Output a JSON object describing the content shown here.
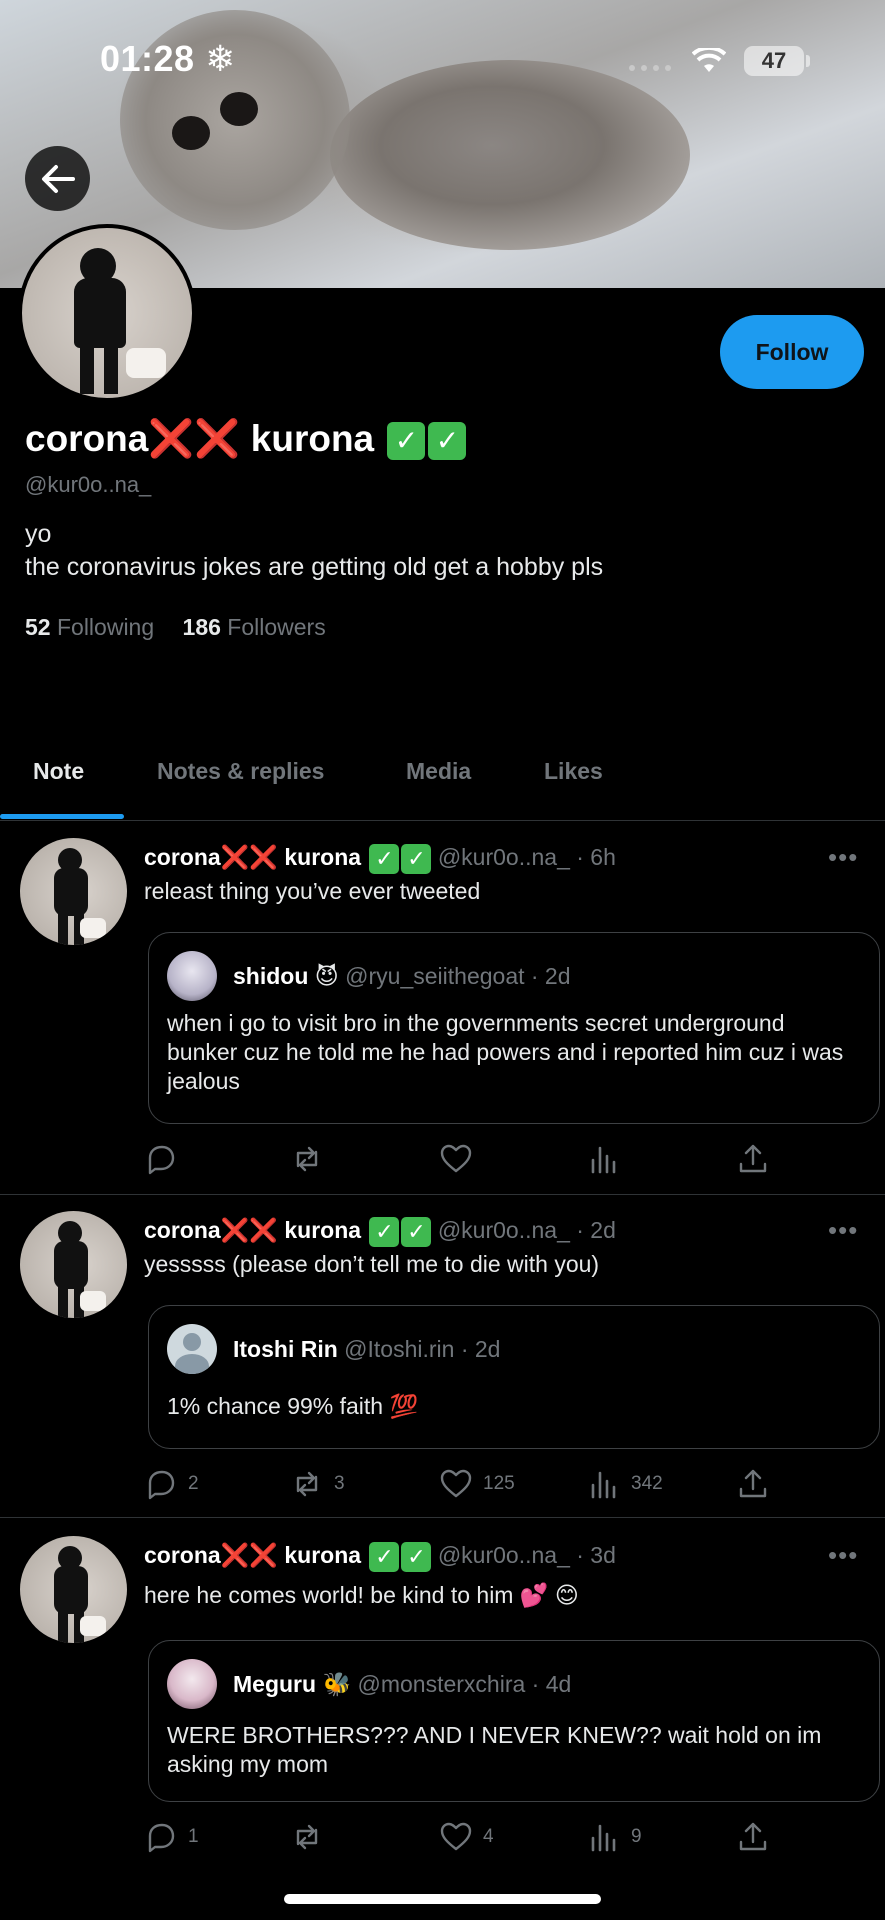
{
  "status_bar": {
    "time": "01:28",
    "time_extra": "❄",
    "battery": "47"
  },
  "profile": {
    "name_part1": "corona",
    "name_x": "❌❌",
    "name_part2": "kurona",
    "name_check": "✓",
    "handle": "@kur0o..na_",
    "bio_line1": "yo",
    "bio_line2": "the coronavirus jokes are getting old get a hobby pls",
    "following_count": "52",
    "following_label": "Following",
    "followers_count": "186",
    "followers_label": "Followers",
    "follow_button": "Follow"
  },
  "tabs": [
    {
      "label": "Note"
    },
    {
      "label": "Notes & replies"
    },
    {
      "label": "Media"
    },
    {
      "label": "Likes"
    }
  ],
  "posts": [
    {
      "author": "corona",
      "author_x": "❌❌",
      "author2": "kurona",
      "check": "✓",
      "meta": "@kur0o..na_ · 6h",
      "text": "releast thing you’ve ever tweeted",
      "quote": {
        "name": "shidou",
        "emoji": "😈",
        "meta": "@ryu_seiithegoat · 2d",
        "text": "when i go to visit bro in the governments secret underground bunker cuz he told me he had powers and i reported him cuz i was jealous"
      },
      "replies": "",
      "reposts": "",
      "likes": "",
      "views": ""
    },
    {
      "author": "corona",
      "author_x": "❌❌",
      "author2": "kurona",
      "check": "✓",
      "meta": "@kur0o..na_ · 2d",
      "text": "yesssss (please don’t tell me to die with you)",
      "quote": {
        "name": "Itoshi Rin",
        "emoji": "",
        "meta": "@Itoshi.rin · 2d",
        "text": "1% chance 99% faith 💯"
      },
      "replies": "2",
      "reposts": "3",
      "likes": "125",
      "views": "342"
    },
    {
      "author": "corona",
      "author_x": "❌❌",
      "author2": "kurona",
      "check": "✓",
      "meta": "@kur0o..na_ · 3d",
      "text": "here he comes world! be kind to him 💕 😊",
      "quote": {
        "name": "Meguru",
        "emoji": "🐝",
        "meta": "@monsterxchira · 4d",
        "text": "WERE BROTHERS??? AND I NEVER KNEW?? wait hold on im asking my mom"
      },
      "replies": "1",
      "reposts": "",
      "likes": "4",
      "views": "9"
    }
  ],
  "colors": {
    "accent": "#1d9bf0",
    "muted": "#71767b",
    "background": "#000000"
  },
  "icons": [
    "back-arrow-icon",
    "wifi-icon",
    "more-icon",
    "reply-icon",
    "repost-icon",
    "like-icon",
    "views-icon",
    "share-icon"
  ]
}
